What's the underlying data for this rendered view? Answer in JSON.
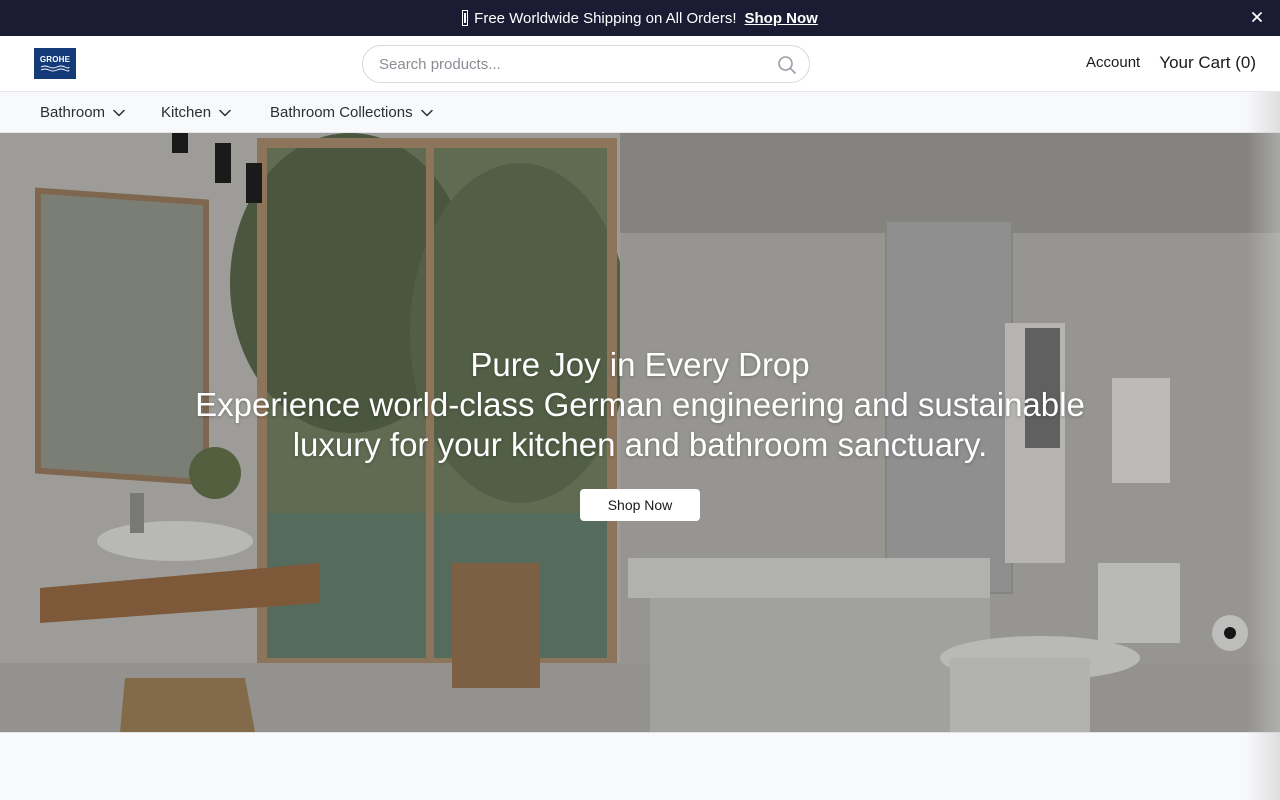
{
  "announcement": {
    "text": "Free Worldwide Shipping on All Orders!",
    "link_label": "Shop Now",
    "gift_icon": "gift-icon",
    "close_icon": "close-icon"
  },
  "header": {
    "logo_text": "GROHE",
    "search_placeholder": "Search products...",
    "search_icon": "search-icon",
    "account_label": "Account",
    "cart_label": "Your Cart (0)"
  },
  "nav": {
    "items": [
      {
        "label": "Bathroom",
        "icon": "chevron-down-icon"
      },
      {
        "label": "Kitchen",
        "icon": "chevron-down-icon"
      },
      {
        "label": "Bathroom Collections",
        "icon": "chevron-down-icon"
      }
    ]
  },
  "hero": {
    "headline": "Pure Joy in Every Drop",
    "subheadline": "Experience world-class German engineering and sustainable luxury for your kitchen and bathroom sanctuary.",
    "cta_label": "Shop Now"
  },
  "colors": {
    "announcement_bg": "#1b1b33",
    "logo_bg": "#143a7a",
    "page_bg": "#f8f9fb"
  }
}
